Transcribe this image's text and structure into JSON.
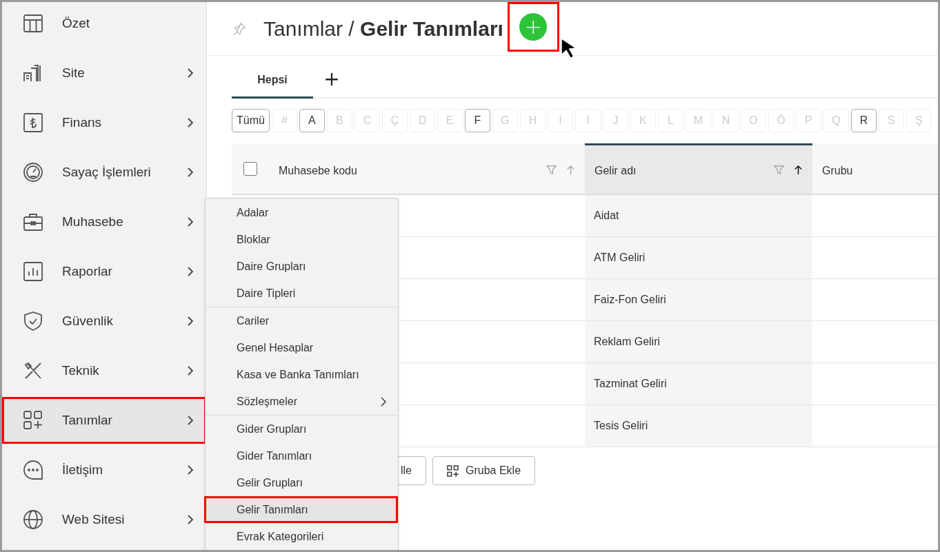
{
  "sidebar": {
    "items": [
      {
        "label": "Özet",
        "submenu": false,
        "selected": false,
        "highlighted": false
      },
      {
        "label": "Site",
        "submenu": true,
        "selected": false,
        "highlighted": false
      },
      {
        "label": "Finans",
        "submenu": true,
        "selected": false,
        "highlighted": false
      },
      {
        "label": "Sayaç İşlemleri",
        "submenu": true,
        "selected": false,
        "highlighted": false
      },
      {
        "label": "Muhasebe",
        "submenu": true,
        "selected": false,
        "highlighted": false
      },
      {
        "label": "Raporlar",
        "submenu": true,
        "selected": false,
        "highlighted": false
      },
      {
        "label": "Güvenlik",
        "submenu": true,
        "selected": false,
        "highlighted": false
      },
      {
        "label": "Teknik",
        "submenu": true,
        "selected": false,
        "highlighted": false
      },
      {
        "label": "Tanımlar",
        "submenu": true,
        "selected": true,
        "highlighted": true
      },
      {
        "label": "İletişim",
        "submenu": true,
        "selected": false,
        "highlighted": false
      },
      {
        "label": "Web Sitesi",
        "submenu": true,
        "selected": false,
        "highlighted": false
      }
    ]
  },
  "submenu": {
    "groups": [
      [
        {
          "label": "Adalar",
          "submenu": false,
          "selected": false,
          "highlighted": false
        },
        {
          "label": "Bloklar",
          "submenu": false,
          "selected": false,
          "highlighted": false
        },
        {
          "label": "Daire Grupları",
          "submenu": false,
          "selected": false,
          "highlighted": false
        },
        {
          "label": "Daire Tipleri",
          "submenu": false,
          "selected": false,
          "highlighted": false
        }
      ],
      [
        {
          "label": "Cariler",
          "submenu": false,
          "selected": false,
          "highlighted": false
        },
        {
          "label": "Genel Hesaplar",
          "submenu": false,
          "selected": false,
          "highlighted": false
        },
        {
          "label": "Kasa ve Banka Tanımları",
          "submenu": false,
          "selected": false,
          "highlighted": false
        },
        {
          "label": "Sözleşmeler",
          "submenu": true,
          "selected": false,
          "highlighted": false
        }
      ],
      [
        {
          "label": "Gider Grupları",
          "submenu": false,
          "selected": false,
          "highlighted": false
        },
        {
          "label": "Gider Tanımları",
          "submenu": false,
          "selected": false,
          "highlighted": false
        },
        {
          "label": "Gelir Grupları",
          "submenu": false,
          "selected": false,
          "highlighted": false
        },
        {
          "label": "Gelir Tanımları",
          "submenu": false,
          "selected": true,
          "highlighted": true
        },
        {
          "label": "Evrak Kategorileri",
          "submenu": false,
          "selected": false,
          "highlighted": false
        }
      ]
    ]
  },
  "header": {
    "title": "Tanımlar / **Gelir Tanımları**",
    "add_button": {
      "label": "+",
      "highlighted": true
    }
  },
  "tabs": [
    {
      "label": "Hepsi",
      "selected": true
    }
  ],
  "add_tab": "+",
  "letters": [
    {
      "label": "Tümü",
      "enabled": true
    },
    {
      "label": "#",
      "enabled": false
    },
    {
      "label": "A",
      "enabled": true
    },
    {
      "label": "B",
      "enabled": false
    },
    {
      "label": "C",
      "enabled": false
    },
    {
      "label": "Ç",
      "enabled": false
    },
    {
      "label": "D",
      "enabled": false
    },
    {
      "label": "E",
      "enabled": false
    },
    {
      "label": "F",
      "enabled": true
    },
    {
      "label": "G",
      "enabled": false
    },
    {
      "label": "H",
      "enabled": false
    },
    {
      "label": "I",
      "enabled": false
    },
    {
      "label": "İ",
      "enabled": false
    },
    {
      "label": "J",
      "enabled": false
    },
    {
      "label": "K",
      "enabled": false
    },
    {
      "label": "L",
      "enabled": false
    },
    {
      "label": "M",
      "enabled": false
    },
    {
      "label": "N",
      "enabled": false
    },
    {
      "label": "O",
      "enabled": false
    },
    {
      "label": "Ö",
      "enabled": false
    },
    {
      "label": "P",
      "enabled": false
    },
    {
      "label": "Q",
      "enabled": false
    },
    {
      "label": "R",
      "enabled": true
    },
    {
      "label": "S",
      "enabled": false
    },
    {
      "label": "Ş",
      "enabled": false
    }
  ],
  "table": {
    "select_all_checked": false,
    "columns": [
      {
        "label": "Muhasebe kodu",
        "sorted": false
      },
      {
        "label": "Gelir adı",
        "sorted": true
      },
      {
        "label": "Grubu",
        "sorted": false
      }
    ],
    "rows": [
      {
        "gelir_adi": "Aidat"
      },
      {
        "gelir_adi": "ATM Geliri"
      },
      {
        "gelir_adi": "Faiz-Fon Geliri"
      },
      {
        "gelir_adi": "Reklam Geliri"
      },
      {
        "gelir_adi": "Tazminat Geliri"
      },
      {
        "gelir_adi": "Tesis Geliri"
      }
    ]
  },
  "actions": [
    {
      "label": "lle",
      "icon": false
    },
    {
      "label": "Gruba Ekle",
      "icon": true
    }
  ]
}
